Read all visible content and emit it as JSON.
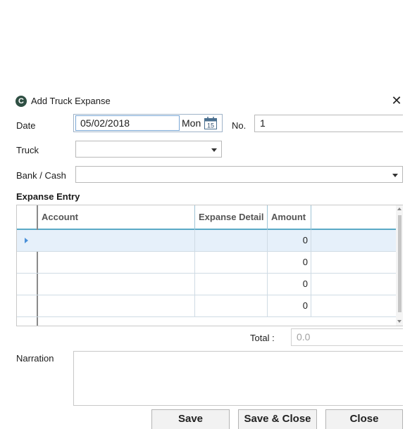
{
  "window": {
    "title": "Add Truck Expanse",
    "icon": "app-logo-icon"
  },
  "form": {
    "date_label": "Date",
    "date_value": "05/02/2018",
    "day_label": "Mon",
    "calendar_day": "15",
    "no_label": "No.",
    "no_value": "1",
    "truck_label": "Truck",
    "truck_value": "",
    "bank_label": "Bank / Cash",
    "bank_value": ""
  },
  "grid": {
    "title": "Expanse Entry",
    "columns": [
      "Account",
      "Expanse Detail",
      "Amount"
    ],
    "rows": [
      {
        "account": "",
        "detail": "",
        "amount": "0"
      },
      {
        "account": "",
        "detail": "",
        "amount": "0"
      },
      {
        "account": "",
        "detail": "",
        "amount": "0"
      },
      {
        "account": "",
        "detail": "",
        "amount": "0"
      }
    ]
  },
  "total": {
    "label": "Total :",
    "value": "0.0"
  },
  "narration": {
    "label": "Narration",
    "value": ""
  },
  "buttons": {
    "save": "Save",
    "save_close": "Save & Close",
    "close": "Close"
  },
  "colors": {
    "selected_row": "#e6f0fa",
    "grid_line": "#b7c9d6",
    "header_line": "#5aa9c6",
    "row_marker": "#4a90d9"
  }
}
